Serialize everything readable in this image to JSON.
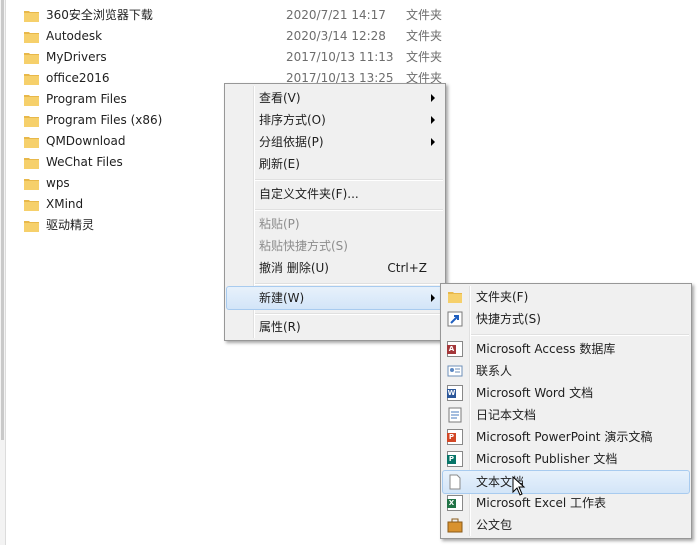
{
  "files": [
    {
      "name": "360安全浏览器下载",
      "date": "2020/7/21 14:17",
      "type": "文件夹"
    },
    {
      "name": "Autodesk",
      "date": "2020/3/14 12:28",
      "type": "文件夹"
    },
    {
      "name": "MyDrivers",
      "date": "2017/10/13 11:13",
      "type": "文件夹"
    },
    {
      "name": "office2016",
      "date": "2017/10/13 13:25",
      "type": "文件夹"
    },
    {
      "name": "Program Files",
      "date": "",
      "type": ""
    },
    {
      "name": "Program Files (x86)",
      "date": "",
      "type": ""
    },
    {
      "name": "QMDownload",
      "date": "",
      "type": ""
    },
    {
      "name": "WeChat Files",
      "date": "",
      "type": ""
    },
    {
      "name": "wps",
      "date": "",
      "type": ""
    },
    {
      "name": "XMind",
      "date": "",
      "type": ""
    },
    {
      "name": "驱动精灵",
      "date": "",
      "type": ""
    }
  ],
  "context_menu": {
    "view": "查看(V)",
    "sort": "排序方式(O)",
    "group": "分组依据(P)",
    "refresh": "刷新(E)",
    "customize": "自定义文件夹(F)...",
    "paste": "粘贴(P)",
    "paste_shortcut": "粘贴快捷方式(S)",
    "undo": "撤消 删除(U)",
    "undo_shortcut": "Ctrl+Z",
    "new": "新建(W)",
    "properties": "属性(R)"
  },
  "new_submenu": {
    "folder": "文件夹(F)",
    "shortcut": "快捷方式(S)",
    "access": "Microsoft Access 数据库",
    "contact": "联系人",
    "word": "Microsoft Word 文档",
    "journal": "日记本文档",
    "powerpoint": "Microsoft PowerPoint 演示文稿",
    "publisher": "Microsoft Publisher 文档",
    "text": "文本文档",
    "excel": "Microsoft Excel 工作表",
    "briefcase": "公文包"
  },
  "colors": {
    "folder": "#f2c94c",
    "highlight": "#d3e5f8",
    "access": "#a4373a",
    "word": "#2b579a",
    "powerpoint": "#d24726",
    "publisher": "#077568",
    "excel": "#217346"
  }
}
